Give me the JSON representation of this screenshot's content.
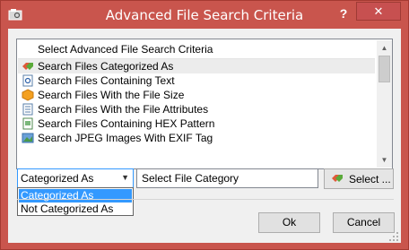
{
  "window": {
    "title": "Advanced File Search Criteria",
    "help_label": "?",
    "close_label": "✕"
  },
  "list": {
    "header": "Select Advanced File Search Criteria",
    "items": [
      {
        "label": "Search Files Categorized As",
        "icon": "category-tags-icon"
      },
      {
        "label": "Search Files Containing Text",
        "icon": "text-document-icon"
      },
      {
        "label": "Search Files With the File Size",
        "icon": "size-box-icon"
      },
      {
        "label": "Search Files With the File Attributes",
        "icon": "attributes-document-icon"
      },
      {
        "label": "Search Files Containing HEX Pattern",
        "icon": "hex-document-icon"
      },
      {
        "label": "Search JPEG Images With EXIF Tag",
        "icon": "image-icon"
      }
    ],
    "selected_index": 0
  },
  "criteria": {
    "combo_value": "Categorized As",
    "options": [
      "Categorized As",
      "Not Categorized As"
    ],
    "selected_option_index": 0,
    "category_text": "Select File Category",
    "select_button": "Select ..."
  },
  "buttons": {
    "ok": "Ok",
    "cancel": "Cancel"
  },
  "colors": {
    "titlebar": "#c9554d",
    "highlight": "#3399ff",
    "dialog_bg": "#f0f0f0"
  }
}
